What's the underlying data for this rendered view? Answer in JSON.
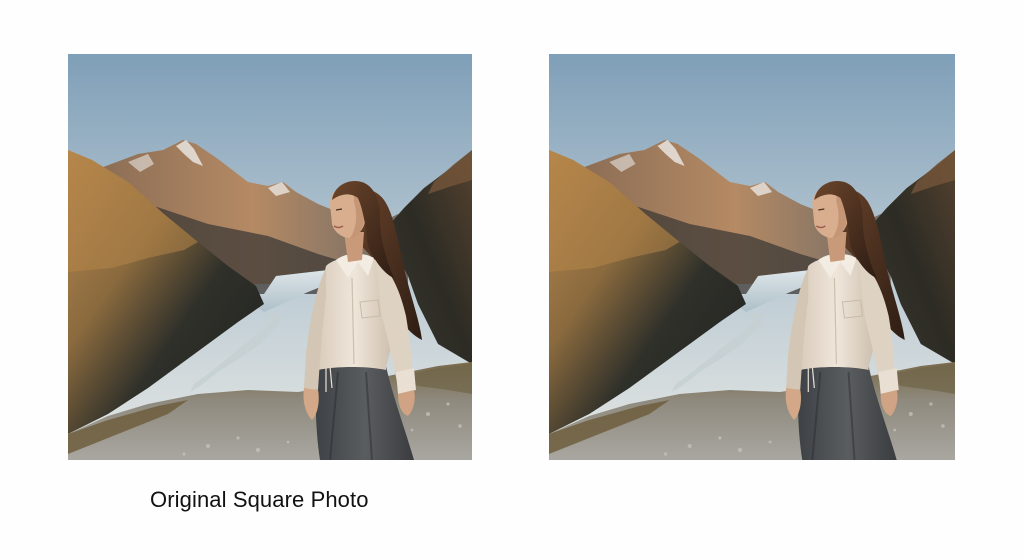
{
  "captions": {
    "left": "Original Square Photo"
  },
  "photos": [
    {
      "subject": "woman standing on mountain trail overlooking alpine valley with glacial lake",
      "role": "original"
    },
    {
      "subject": "woman standing on mountain trail overlooking alpine valley with glacial lake",
      "role": "copy"
    }
  ],
  "colors": {
    "sky_top": "#7f9fb8",
    "sky_bottom": "#e4e6e3",
    "mountain_lit": "#a57a50",
    "mountain_shadow": "#2a2a26",
    "lake": "#c9d8df",
    "shirt": "#e8ddd0",
    "skirt": "#4c4f52",
    "hair": "#4a2e1d"
  }
}
